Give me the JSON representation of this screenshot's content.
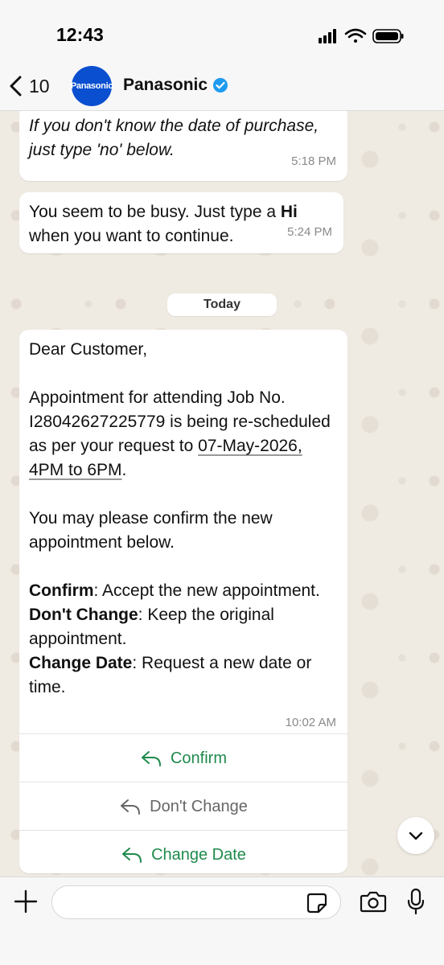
{
  "status_bar": {
    "time": "12:43"
  },
  "header": {
    "back_count": "10",
    "avatar_text": "Panasonic",
    "contact_name": "Panasonic"
  },
  "messages": [
    {
      "text": "If you don't know the date of purchase, just type 'no' below.",
      "time": "5:18 PM"
    },
    {
      "text_before": "You seem to be busy. Just type a ",
      "bold": "Hi",
      "text_after": " when you want to continue.",
      "time": "5:24 PM"
    }
  ],
  "date_divider": "Today",
  "template_message": {
    "greeting": "Dear Customer,",
    "body_1": "Appointment for attending Job No. I28042627225779 is being re-scheduled as per your request to ",
    "date_link": "07-May-2026, 4PM to 6PM",
    "body_1_end": ".",
    "body_2": "You may please confirm the new appointment below.",
    "opt1_label": "Confirm",
    "opt1_desc": ": Accept the new appointment.",
    "opt2_label": "Don't Change",
    "opt2_desc": ": Keep the original appointment.",
    "opt3_label": "Change Date",
    "opt3_desc": ": Request a new date or time.",
    "time": "10:02 AM",
    "buttons": [
      "Confirm",
      "Don't Change",
      "Change Date"
    ]
  },
  "input": {
    "placeholder": ""
  },
  "colors": {
    "accent_green": "#1f8a4c",
    "brand_blue": "#0a4fd0",
    "verified_blue": "#1d9bf0"
  },
  "icons": [
    "chevron-left-icon",
    "verified-badge-icon",
    "reply-icon",
    "chevron-down-icon",
    "plus-icon",
    "sticker-icon",
    "camera-icon",
    "microphone-icon",
    "signal-icon",
    "wifi-icon",
    "battery-icon"
  ]
}
